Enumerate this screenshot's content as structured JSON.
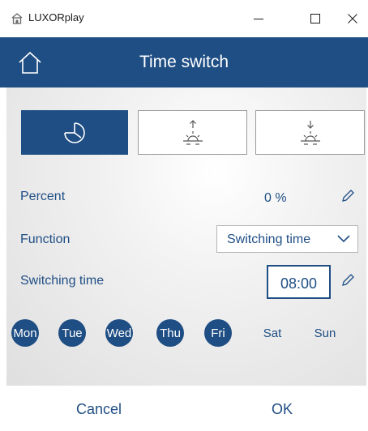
{
  "window": {
    "title": "LUXORplay",
    "controls": {
      "minimize_icon": "minimize-icon",
      "maximize_icon": "maximize-icon",
      "close_icon": "close-icon"
    }
  },
  "header": {
    "title": "Time switch",
    "home_icon": "home-icon"
  },
  "modes": [
    {
      "name": "clock",
      "icon": "clock-icon",
      "active": true
    },
    {
      "name": "sunrise",
      "icon": "sunrise-icon",
      "active": false
    },
    {
      "name": "sunset",
      "icon": "sunset-icon",
      "active": false
    }
  ],
  "percent": {
    "label": "Percent",
    "value": "0 %"
  },
  "function": {
    "label": "Function",
    "value": "Switching time"
  },
  "switching_time": {
    "label": "Switching time",
    "value": "08:00"
  },
  "days": [
    {
      "label": "Mon",
      "selected": true
    },
    {
      "label": "Tue",
      "selected": true
    },
    {
      "label": "Wed",
      "selected": true
    },
    {
      "label": "Thu",
      "selected": true
    },
    {
      "label": "Fri",
      "selected": true
    },
    {
      "label": "Sat",
      "selected": false
    },
    {
      "label": "Sun",
      "selected": false
    }
  ],
  "footer": {
    "cancel_label": "Cancel",
    "ok_label": "OK"
  },
  "colors": {
    "accent": "#1f4e84",
    "background": "#ffffff",
    "panel": "#e6e6e6"
  }
}
